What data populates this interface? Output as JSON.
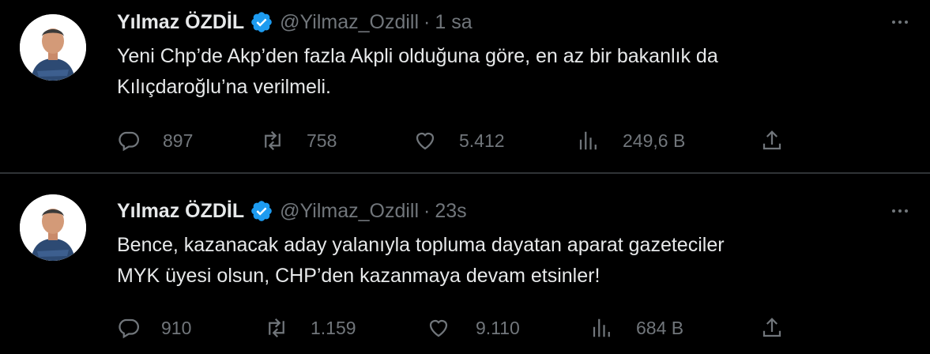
{
  "colors": {
    "background": "#000000",
    "text_primary": "#e7e9ea",
    "text_secondary": "#71767b",
    "verified": "#1d9bf0",
    "divider": "#2f3336"
  },
  "tweets": [
    {
      "author": {
        "name": "Yılmaz ÖZDİL",
        "handle": "@Yilmaz_Ozdill",
        "verified_icon": "verified-badge-icon"
      },
      "separator": "·",
      "time": "1 sa",
      "text_lines": [
        "Yeni Chp’de Akp’den fazla Akpli olduğuna göre, en az bir bakanlık da",
        "Kılıçdaroğlu’na verilmeli."
      ],
      "stats": {
        "replies": "897",
        "retweets": "758",
        "likes": "5.412",
        "views": "249,6 B"
      }
    },
    {
      "author": {
        "name": "Yılmaz ÖZDİL",
        "handle": "@Yilmaz_Ozdill",
        "verified_icon": "verified-badge-icon"
      },
      "separator": "·",
      "time": "23s",
      "text_lines": [
        "Bence, kazanacak aday yalanıyla topluma dayatan aparat gazeteciler",
        "MYK üyesi olsun, CHP’den kazanmaya devam etsinler!"
      ],
      "stats": {
        "replies": "910",
        "retweets": "1.159",
        "likes": "9.110",
        "views": "684 B"
      }
    }
  ]
}
